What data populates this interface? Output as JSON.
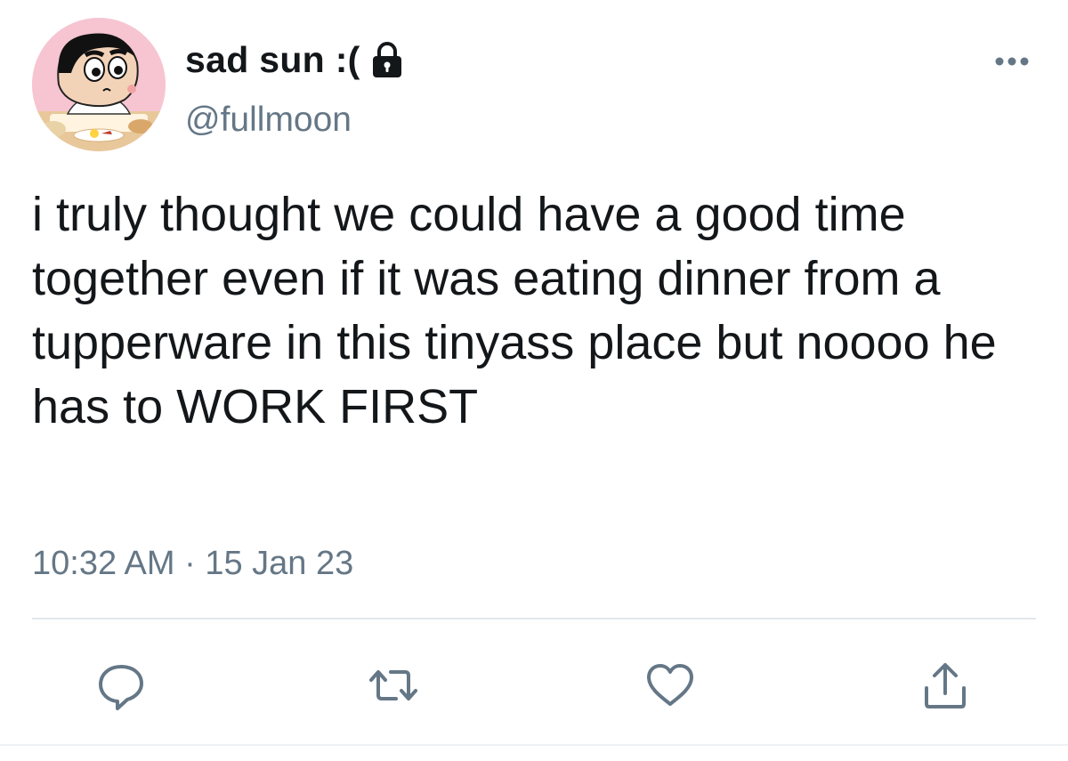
{
  "tweet": {
    "display_name": "sad sun :(",
    "handle": "@fullmoon",
    "text": "i truly thought we could have a good time together even if it was eating dinner from a tupperware in this tinyass place but noooo he has to WORK FIRST",
    "time": "10:32 AM",
    "separator": "·",
    "date": "15 Jan 23"
  },
  "icons": {
    "lock": "lock-icon",
    "more": "more-icon",
    "reply": "reply-icon",
    "retweet": "retweet-icon",
    "like": "like-icon",
    "share": "share-icon"
  },
  "colors": {
    "text": "#14171a",
    "secondary": "#657786",
    "icon": "#657786",
    "divider": "#e1e8ed"
  }
}
